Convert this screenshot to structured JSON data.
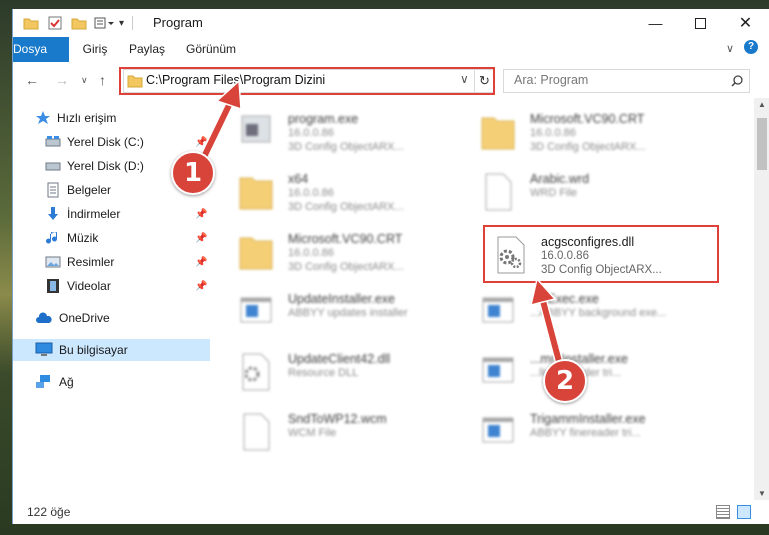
{
  "window": {
    "title": "Program"
  },
  "ribbon": {
    "tabs": [
      "Dosya",
      "Giriş",
      "Paylaş",
      "Görünüm"
    ]
  },
  "address": {
    "path": "C:\\Program Files\\Program Dizini"
  },
  "search": {
    "placeholder": "Ara: Program"
  },
  "sidebar": {
    "items": [
      {
        "label": "Hızlı erişim",
        "icon": "star-icon"
      },
      {
        "label": "Yerel Disk (C:)",
        "icon": "drive-icon",
        "pinned": true
      },
      {
        "label": "Yerel Disk (D:)",
        "icon": "drive-icon",
        "pinned": true
      },
      {
        "label": "Belgeler",
        "icon": "documents-icon",
        "pinned": true
      },
      {
        "label": "İndirmeler",
        "icon": "download-icon",
        "pinned": true
      },
      {
        "label": "Müzik",
        "icon": "music-icon",
        "pinned": true
      },
      {
        "label": "Resimler",
        "icon": "pictures-icon",
        "pinned": true
      },
      {
        "label": "Videolar",
        "icon": "videos-icon",
        "pinned": true
      },
      {
        "label": "OneDrive",
        "icon": "cloud-icon"
      },
      {
        "label": "Bu bilgisayar",
        "icon": "computer-icon",
        "selected": true
      },
      {
        "label": "Ağ",
        "icon": "network-icon"
      }
    ]
  },
  "files": [
    {
      "name": "program.exe",
      "line1": "16.0.0.86",
      "line2": "3D Config ObjectARX...",
      "icon": "program-icon"
    },
    {
      "name": "Microsoft.VC90.CRT",
      "line1": "16.0.0.86",
      "line2": "3D Config ObjectARX...",
      "icon": "folder-icon"
    },
    {
      "name": "x64",
      "line1": "16.0.0.86",
      "line2": "3D Config ObjectARX...",
      "icon": "folder-icon"
    },
    {
      "name": "Arabic.wrd",
      "line1": "WRD File",
      "line2": "",
      "icon": "file-icon"
    },
    {
      "name": "Microsoft.VC90.CRT",
      "line1": "16.0.0.86",
      "line2": "3D Config ObjectARX...",
      "icon": "folder-icon"
    },
    {
      "name": "acgsconfigres.dll",
      "line1": "16.0.0.86",
      "line2": "3D Config ObjectARX...",
      "icon": "dll-gear-icon"
    },
    {
      "name": "UpdateInstaller.exe",
      "line1": "ABBYY updates installer",
      "line2": "",
      "icon": "app-icon"
    },
    {
      "name": "...eExec.exe",
      "line1": "...ABBYY background exe...",
      "line2": "",
      "icon": "app-icon"
    },
    {
      "name": "UpdateClient42.dll",
      "line1": "Resource DLL",
      "line2": "",
      "icon": "dll-gear-icon"
    },
    {
      "name": "...mmInstaller.exe",
      "line1": "...ller extender tri...",
      "line2": "",
      "icon": "app-icon"
    },
    {
      "name": "SndToWP12.wcm",
      "line1": "WCM File",
      "line2": "",
      "icon": "file-icon"
    },
    {
      "name": "TrigammInstaller.exe",
      "line1": "ABBYY finereader tri...",
      "line2": "",
      "icon": "app-icon"
    }
  ],
  "status": {
    "count": "122 öğe"
  },
  "callouts": [
    {
      "number": "1"
    },
    {
      "number": "2"
    }
  ],
  "colors": {
    "accent": "#1979ca",
    "highlight": "#e0403a",
    "selection": "#cce8ff"
  }
}
